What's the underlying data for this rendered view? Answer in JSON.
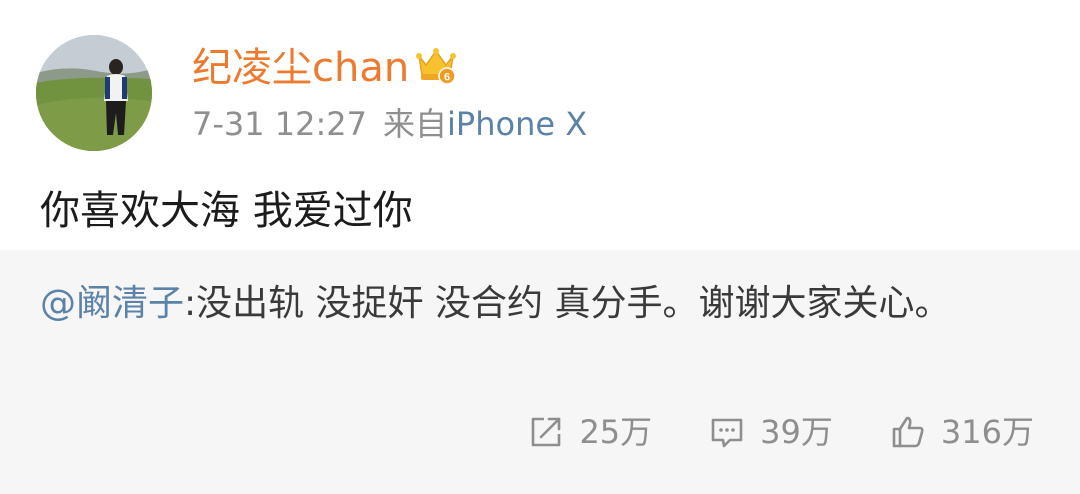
{
  "post": {
    "author": {
      "name": "纪凌尘chan",
      "badge_icon": "crown-vip-badge-icon",
      "name_color": "#ec7b2f"
    },
    "time": "7-31 12:27",
    "source_prefix": "来自",
    "source_device": "iPhone X",
    "text": "你喜欢大海 我爱过你"
  },
  "repost": {
    "mention": "@阚清子",
    "text": ":没出轨 没捉奸 没合约 真分手。谢谢大家关心。",
    "link_color": "#5b82a8",
    "background": "#f6f6f6"
  },
  "actions": {
    "share": {
      "icon": "share-icon",
      "count": "25万"
    },
    "comment": {
      "icon": "comment-icon",
      "count": "39万"
    },
    "like": {
      "icon": "thumbs-up-icon",
      "count": "316万"
    }
  }
}
